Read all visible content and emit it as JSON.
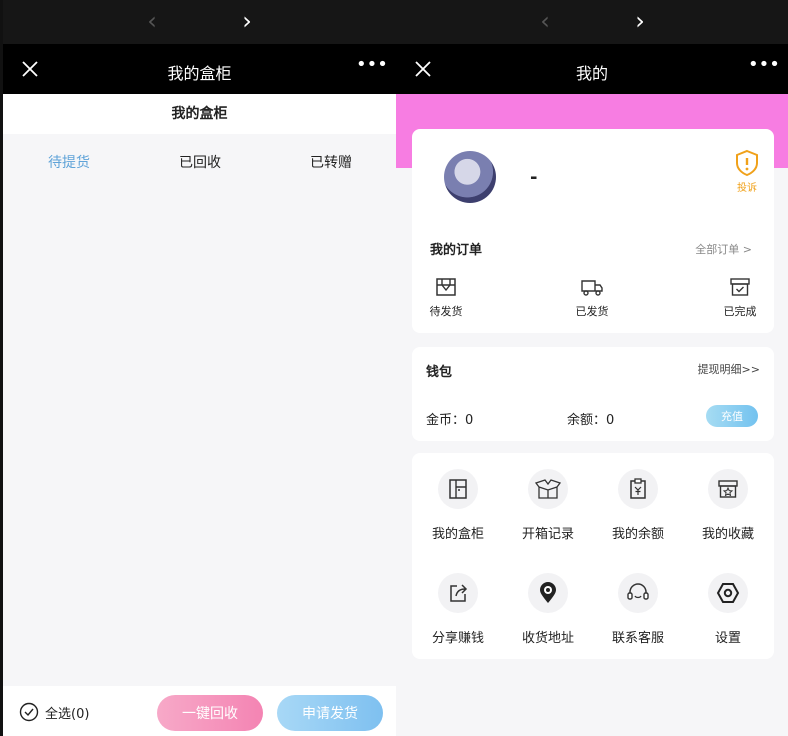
{
  "left": {
    "title": "我的盒柜",
    "subhead": "我的盒柜",
    "tabs": [
      {
        "label": "待提货",
        "active": true
      },
      {
        "label": "已回收",
        "active": false
      },
      {
        "label": "已转赠",
        "active": false
      }
    ],
    "select_all": "全选(0)",
    "recycle_button": "一键回收",
    "ship_button": "申请发货"
  },
  "right": {
    "title": "我的",
    "username": "-",
    "complain_label": "投诉",
    "orders": {
      "title": "我的订单",
      "all_label": "全部订单",
      "items": [
        {
          "label": "待发货",
          "icon": "pending-ship-icon"
        },
        {
          "label": "已发货",
          "icon": "truck-icon"
        },
        {
          "label": "已完成",
          "icon": "archive-check-icon"
        }
      ]
    },
    "wallet": {
      "title": "钱包",
      "detail_link": "提现明细>>",
      "coin": "金币：0",
      "balance": "余额：0",
      "recharge": "充值"
    },
    "menu": [
      {
        "label": "我的盒柜",
        "icon": "cabinet-icon"
      },
      {
        "label": "开箱记录",
        "icon": "open-box-icon"
      },
      {
        "label": "我的余额",
        "icon": "clipboard-yen-icon"
      },
      {
        "label": "我的收藏",
        "icon": "star-box-icon"
      },
      {
        "label": "分享赚钱",
        "icon": "share-icon"
      },
      {
        "label": "收货地址",
        "icon": "location-pin-icon"
      },
      {
        "label": "联系客服",
        "icon": "headset-icon"
      },
      {
        "label": "设置",
        "icon": "gear-icon"
      }
    ]
  },
  "colors": {
    "accent_blue": "#5fa3d8",
    "pink_band": "#f77de2",
    "complain_orange": "#f0a11a"
  }
}
